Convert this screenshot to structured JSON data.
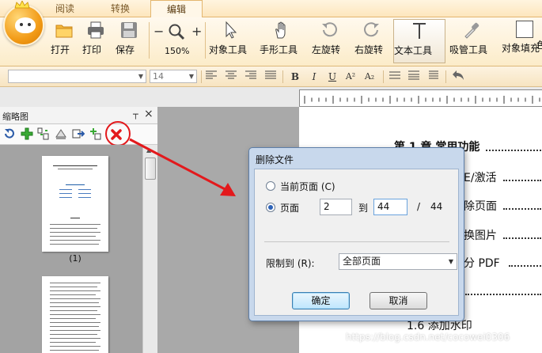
{
  "tabs": [
    {
      "label": "阅读",
      "active": false
    },
    {
      "label": "转换",
      "active": false
    },
    {
      "label": "编辑",
      "active": true
    }
  ],
  "ribbon": {
    "open_label": "打开",
    "print_label": "打印",
    "save_label": "保存",
    "zoom_minus": "−",
    "zoom_plus": "+",
    "zoom_level": "150%",
    "object_tool_label": "对象工具",
    "hand_tool_label": "手形工具",
    "rotate_left_label": "左旋转",
    "rotate_right_label": "右旋转",
    "text_tool_label": "文本工具",
    "eyedropper_label": "吸管工具",
    "object_fill_label": "对象填充",
    "object_fill_label2": "色"
  },
  "format": {
    "font_name": "",
    "font_size": "14",
    "bold": "B",
    "italic": "I",
    "underline": "U",
    "superscript": "A²",
    "subscript": "A₂"
  },
  "thumbnail_panel": {
    "title": "缩略图",
    "pin": "ꟷ",
    "close": "×",
    "page1_label": "(1)"
  },
  "document": {
    "heading": "第 1 章  常用功能",
    "line1": "E/激活",
    "line2": "除页面",
    "line3": "换图片",
    "line4": "分 PDF",
    "line5": "1.6 添加水印"
  },
  "dialog": {
    "title": "删除文件",
    "current_page_label": "当前页面 (C)",
    "pages_label": "页面",
    "from_value": "2",
    "to_label": "到",
    "to_value": "44",
    "slash": "/",
    "total_pages": "44",
    "restrict_label": "限制到 (R):",
    "restrict_value": "全部页面",
    "ok_label": "确定",
    "cancel_label": "取消"
  },
  "watermark": "https://blog.csdn.net/cocowei0306",
  "colors": {
    "accent_orange": "#f29b17",
    "highlight_red": "#e3191c",
    "dialog_frame": "#c8d8ec"
  }
}
